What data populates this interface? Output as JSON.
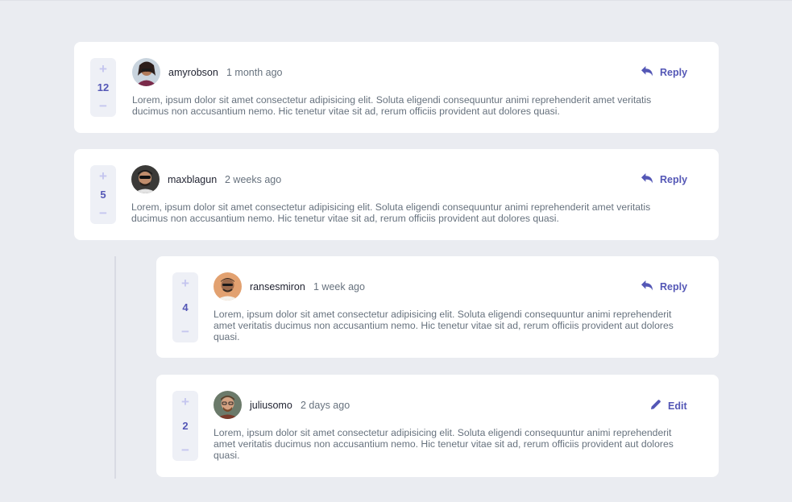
{
  "colors": {
    "background": "#eaecf1",
    "card": "#ffffff",
    "accent": "#5457b6",
    "vote_bg": "#eef0f6",
    "vote_icon": "#c5c6ef",
    "text": "#67727e",
    "username": "#1f2230"
  },
  "comments": [
    {
      "username": "amyrobson",
      "time": "1 month ago",
      "score": "12",
      "action": "Reply",
      "action_icon": "reply-icon",
      "avatar_icon": "avatar-amyrobson",
      "text": "Lorem, ipsum dolor sit amet consectetur adipisicing elit. Soluta eligendi consequuntur animi reprehenderit amet veritatis ducimus non accusantium nemo. Hic tenetur vitae sit ad, rerum officiis provident aut dolores quasi."
    },
    {
      "username": "maxblagun",
      "time": "2 weeks ago",
      "score": "5",
      "action": "Reply",
      "action_icon": "reply-icon",
      "avatar_icon": "avatar-maxblagun",
      "text": "Lorem, ipsum dolor sit amet consectetur adipisicing elit. Soluta eligendi consequuntur animi reprehenderit amet veritatis ducimus non accusantium nemo. Hic tenetur vitae sit ad, rerum officiis provident aut dolores quasi."
    },
    {
      "username": "ransesmiron",
      "time": "1 week ago",
      "score": "4",
      "action": "Reply",
      "action_icon": "reply-icon",
      "avatar_icon": "avatar-ransesmiron",
      "text": "Lorem, ipsum dolor sit amet consectetur adipisicing elit. Soluta eligendi consequuntur animi reprehenderit amet veritatis ducimus non accusantium nemo. Hic tenetur vitae sit ad, rerum officiis provident aut dolores quasi."
    },
    {
      "username": "juliusomo",
      "time": "2 days ago",
      "score": "2",
      "action": "Edit",
      "action_icon": "edit-icon",
      "avatar_icon": "avatar-juliusomo",
      "text": "Lorem, ipsum dolor sit amet consectetur adipisicing elit. Soluta eligendi consequuntur animi reprehenderit amet veritatis ducimus non accusantium nemo. Hic tenetur vitae sit ad, rerum officiis provident aut dolores quasi."
    }
  ],
  "vote": {
    "plus": "+",
    "minus": "−"
  }
}
